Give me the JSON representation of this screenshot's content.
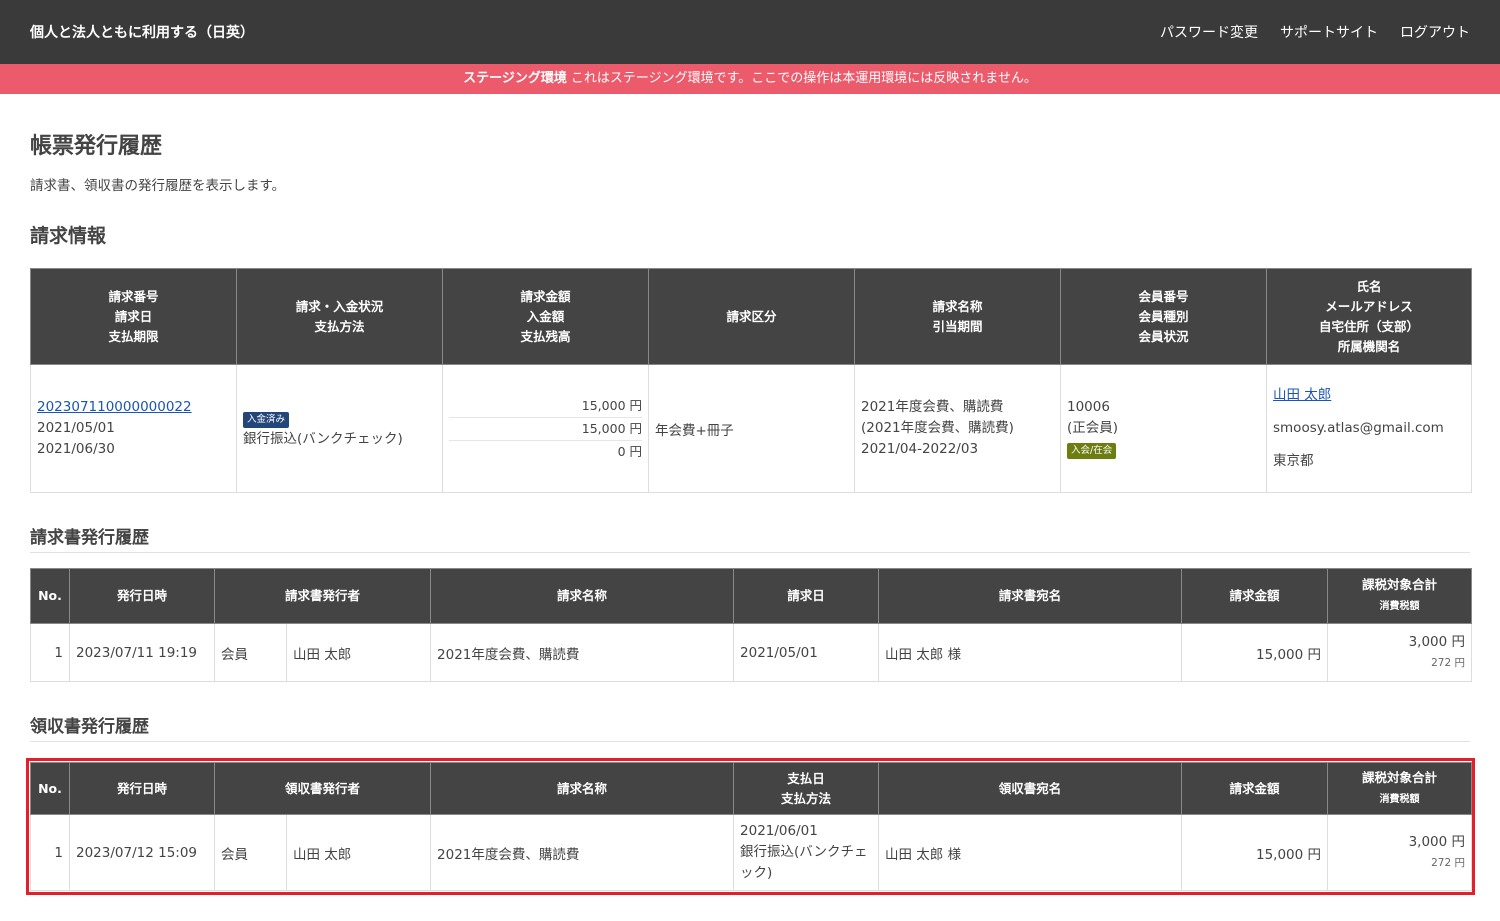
{
  "header": {
    "brand": "個人と法人ともに利用する（日英）",
    "nav": [
      "パスワード変更",
      "サポートサイト",
      "ログアウト"
    ]
  },
  "banner": {
    "label": "ステージング環境",
    "message": "これはステージング環境です。ここでの操作は本運用環境には反映されません。",
    "color": "#ec5b6b"
  },
  "page": {
    "title": "帳票発行履歴",
    "description": "請求書、領収書の発行履歴を表示します。"
  },
  "billing_section": {
    "heading": "請求情報",
    "headers": [
      "請求番号\n請求日\n支払期限",
      "請求・入金状況\n支払方法",
      "請求金額\n入金額\n支払残高",
      "請求区分",
      "請求名称\n引当期間",
      "会員番号\n会員種別\n会員状況",
      "氏名\nメールアドレス\n自宅住所（支部）\n所属機関名"
    ],
    "row": {
      "invoice_no": "202307110000000022",
      "invoice_date": "2021/05/01",
      "due_date": "2021/06/30",
      "status_badge": "入金済み",
      "payment_method": "銀行振込(バンクチェック)",
      "amount": "15,000 円",
      "paid": "15,000 円",
      "balance": "0 円",
      "category": "年会費+冊子",
      "name_line1": "2021年度会費、購読費",
      "name_line2": "(2021年度会費、購読費)",
      "period": "2021/04-2022/03",
      "member_no": "10006",
      "member_type": "(正会員)",
      "member_status": "入会/在会",
      "person_name": "山田 太郎",
      "email": "smoosy.atlas@gmail.com",
      "address": "東京都"
    }
  },
  "invoice_history": {
    "heading": "請求書発行履歴",
    "headers": {
      "no": "No.",
      "issued_at": "発行日時",
      "issuer": "請求書発行者",
      "title": "請求名称",
      "date": "請求日",
      "recipient": "請求書宛名",
      "amount": "請求金額",
      "taxable": "課税対象合計",
      "tax": "消費税額"
    },
    "rows": [
      {
        "no": "1",
        "issued_at": "2023/07/11 19:19",
        "issuer_type": "会員",
        "issuer_name": "山田 太郎",
        "title": "2021年度会費、購読費",
        "date": "2021/05/01",
        "recipient": "山田 太郎 様",
        "amount": "15,000 円",
        "taxable": "3,000 円",
        "tax": "272 円"
      }
    ]
  },
  "receipt_history": {
    "heading": "領収書発行履歴",
    "headers": {
      "no": "No.",
      "issued_at": "発行日時",
      "issuer": "領収書発行者",
      "title": "請求名称",
      "date": "支払日",
      "method": "支払方法",
      "recipient": "領収書宛名",
      "amount": "請求金額",
      "taxable": "課税対象合計",
      "tax": "消費税額"
    },
    "rows": [
      {
        "no": "1",
        "issued_at": "2023/07/12 15:09",
        "issuer_type": "会員",
        "issuer_name": "山田 太郎",
        "title": "2021年度会費、購読費",
        "pay_date": "2021/06/01",
        "pay_method": "銀行振込(バンクチェック)",
        "recipient": "山田 太郎 様",
        "amount": "15,000 円",
        "taxable": "3,000 円",
        "tax": "272 円"
      }
    ],
    "highlight_color": "#e41e2b"
  }
}
